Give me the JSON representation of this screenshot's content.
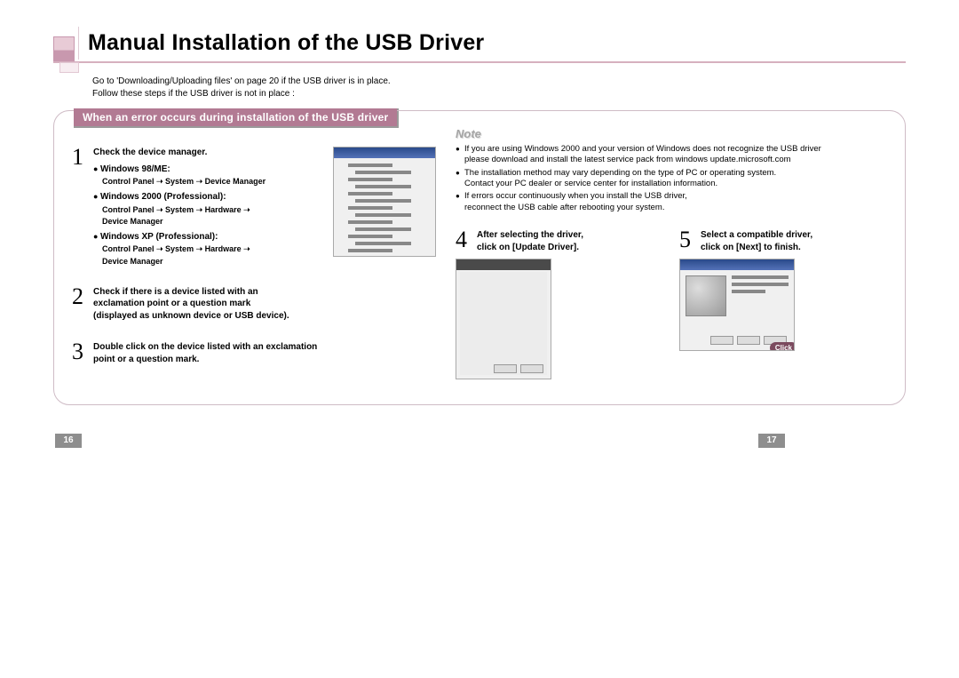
{
  "title": "Manual Installation of the USB Driver",
  "intro_line1": "Go to 'Downloading/Uploading files' on page 20 if the USB driver is in place.",
  "intro_line2": "Follow these steps if the USB driver is not in place :",
  "subtitle": "When an error occurs during installation of the USB driver",
  "step1": {
    "num": "1",
    "head": "Check the device manager.",
    "os1": "Windows 98/ME:",
    "os1_path": "Control Panel ➝ System ➝ Device Manager",
    "os2": "Windows 2000 (Professional):",
    "os2_path1": "Control Panel ➝ System ➝ Hardware ➝",
    "os2_path2": "Device Manager",
    "os3": "Windows XP (Professional):",
    "os3_path1": "Control Panel ➝ System ➝ Hardware ➝",
    "os3_path2": "Device Manager"
  },
  "step2": {
    "num": "2",
    "text1": "Check if there is a device listed with an",
    "text2": "exclamation point or a question mark",
    "text3": "(displayed as unknown device or USB device)."
  },
  "step3": {
    "num": "3",
    "text1": "Double click on the device listed with an exclamation",
    "text2": "point or a question mark."
  },
  "note": {
    "header": "Note",
    "n1a": "If you are using Windows 2000 and your version of Windows does not recognize the USB driver",
    "n1b": "please download and install the latest service pack from windows update.microsoft.com",
    "n2a": "The installation method may vary depending on the type of PC or operating system.",
    "n2b": "Contact your PC dealer or service center for installation information.",
    "n3a": "If errors occur continuously when you install the USB driver,",
    "n3b": "reconnect the USB cable after rebooting your system."
  },
  "step4": {
    "num": "4",
    "text1": "After selecting the driver,",
    "text2": "click on [Update Driver]."
  },
  "step5": {
    "num": "5",
    "text1": "Select a compatible driver,",
    "text2": "click on [Next] to finish."
  },
  "click_label": "Click",
  "page_left": "16",
  "page_right": "17"
}
